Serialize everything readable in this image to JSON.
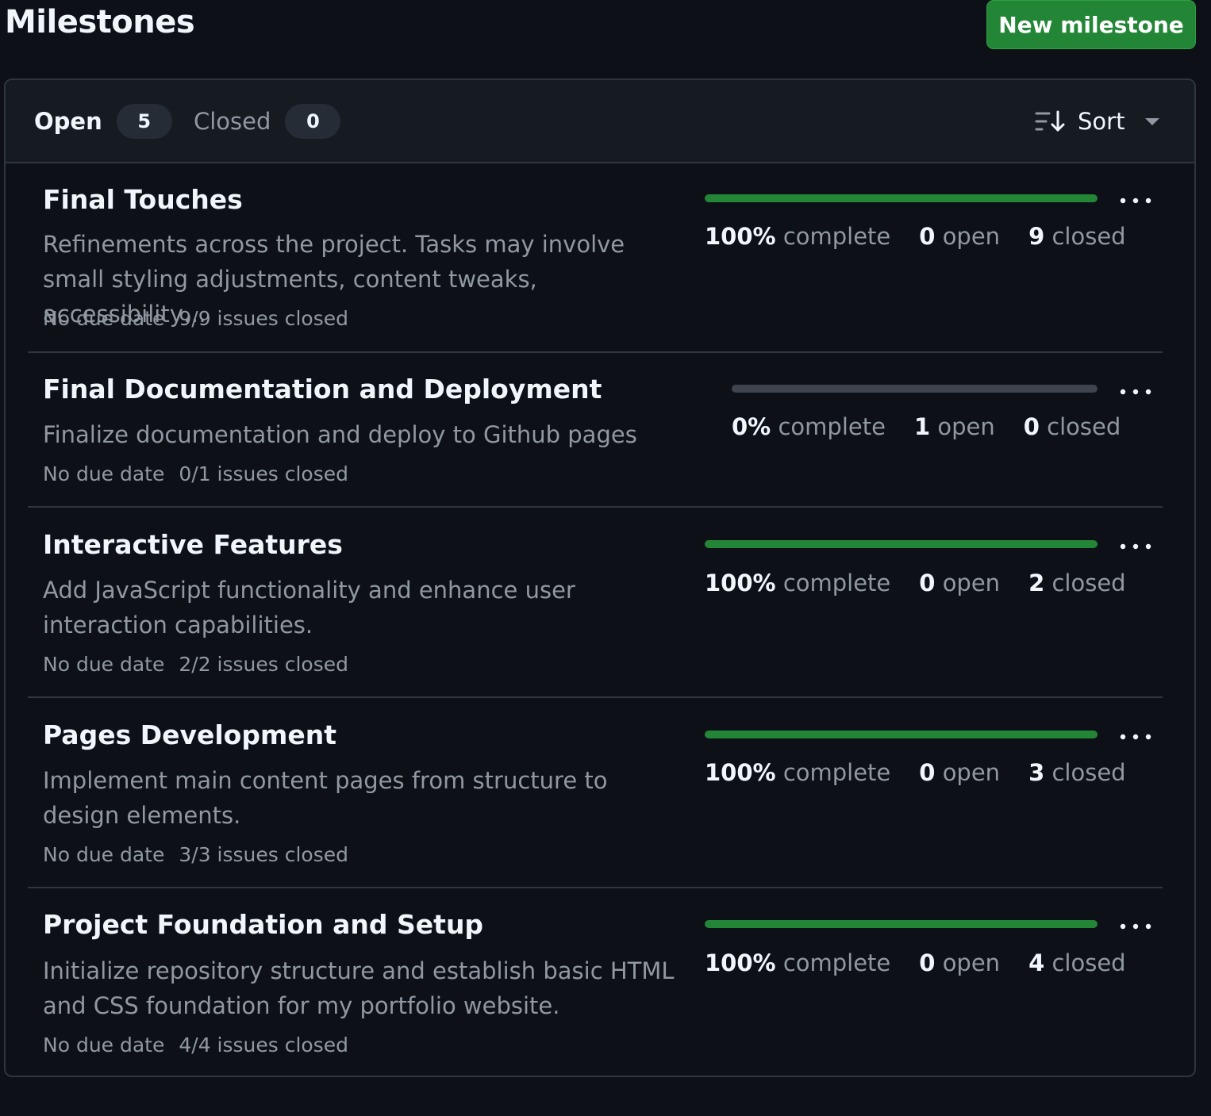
{
  "header": {
    "title": "Milestones",
    "new_button": "New milestone"
  },
  "filters": {
    "open_label": "Open",
    "open_count": "5",
    "closed_label": "Closed",
    "closed_count": "0",
    "sort_label": "Sort"
  },
  "colors": {
    "accent_green": "#238636",
    "background": "#0d1117",
    "header_bg": "#161b22"
  },
  "milestones": [
    {
      "title": "Final Touches",
      "description": "Refinements across the project. Tasks may involve small styling adjustments, content tweaks, accessibility…",
      "due": "No due date",
      "issues_closed": "9/9 issues closed",
      "percent": "100%",
      "percent_label": "complete",
      "open_count": "0",
      "open_label": "open",
      "closed_count": "9",
      "closed_label": "closed",
      "progress": 1.0
    },
    {
      "title": "Final Documentation and Deployment",
      "description": "Finalize documentation and deploy to Github pages",
      "due": "No due date",
      "issues_closed": "0/1 issues closed",
      "percent": "0%",
      "percent_label": "complete",
      "open_count": "1",
      "open_label": "open",
      "closed_count": "0",
      "closed_label": "closed",
      "progress": 0.0
    },
    {
      "title": "Interactive Features",
      "description": "Add JavaScript functionality and enhance user interaction capabilities.",
      "due": "No due date",
      "issues_closed": "2/2 issues closed",
      "percent": "100%",
      "percent_label": "complete",
      "open_count": "0",
      "open_label": "open",
      "closed_count": "2",
      "closed_label": "closed",
      "progress": 1.0
    },
    {
      "title": "Pages Development",
      "description": "Implement main content pages from structure to design elements.",
      "due": "No due date",
      "issues_closed": "3/3 issues closed",
      "percent": "100%",
      "percent_label": "complete",
      "open_count": "0",
      "open_label": "open",
      "closed_count": "3",
      "closed_label": "closed",
      "progress": 1.0
    },
    {
      "title": "Project Foundation and Setup",
      "description": "Initialize repository structure and establish basic HTML and CSS foundation for my portfolio website.",
      "due": "No due date",
      "issues_closed": "4/4 issues closed",
      "percent": "100%",
      "percent_label": "complete",
      "open_count": "0",
      "open_label": "open",
      "closed_count": "4",
      "closed_label": "closed",
      "progress": 1.0
    }
  ]
}
